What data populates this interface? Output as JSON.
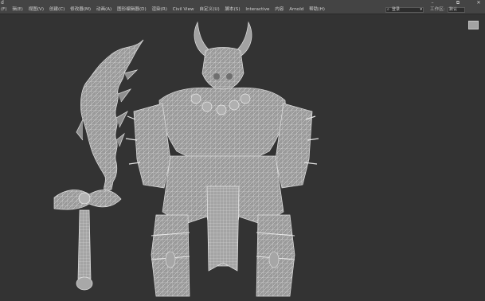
{
  "window": {
    "app_label": "d",
    "minimize_glyph": "–",
    "maximize_glyph": "⧉",
    "close_glyph": "✕"
  },
  "menu": {
    "items": [
      "(F)",
      "辑(E)",
      "视图(V)",
      "创建(C)",
      "修改器(M)",
      "动画(A)",
      "图形编辑器(D)",
      "渲染(R)",
      "Civil View",
      "自定义(U)",
      "脚本(S)",
      "Interactive",
      "内容",
      "Arnold",
      "帮助(H)"
    ]
  },
  "toolbar_right": {
    "search_icon": "search-icon",
    "search_value": "登录",
    "workspace_label": "工作区:",
    "workspace_value": "默认"
  },
  "viewport": {
    "background": "#333333",
    "wire_color": "#d8d8d8",
    "shade_color": "#9c9c9c",
    "viewcube_icon": "viewcube-icon"
  }
}
